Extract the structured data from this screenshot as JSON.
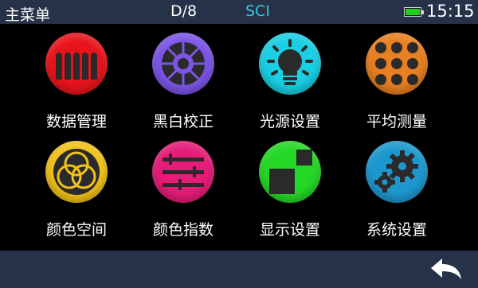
{
  "statusbar": {
    "title": "主菜单",
    "mode": "D/8",
    "mode2": "SCI",
    "time": "15:15",
    "battery_level": 1.0,
    "battery_color": "#22d11f"
  },
  "menu": [
    {
      "label": "数据管理",
      "icon": "data-management-icon",
      "color": "#e8141c"
    },
    {
      "label": "黑白校正",
      "icon": "calibration-wheel-icon",
      "color": "#7b55e6"
    },
    {
      "label": "光源设置",
      "icon": "light-bulb-icon",
      "color": "#19cfe4"
    },
    {
      "label": "平均测量",
      "icon": "dot-grid-icon",
      "color": "#e87f20"
    },
    {
      "label": "颜色空间",
      "icon": "color-space-icon",
      "color": "#f2c11a"
    },
    {
      "label": "颜色指数",
      "icon": "sliders-icon",
      "color": "#e61c78"
    },
    {
      "label": "显示设置",
      "icon": "display-squares-icon",
      "color": "#25d826"
    },
    {
      "label": "系统设置",
      "icon": "gears-icon",
      "color": "#1d98cf"
    }
  ],
  "bottombar": {
    "back_icon": "back-arrow-icon"
  }
}
